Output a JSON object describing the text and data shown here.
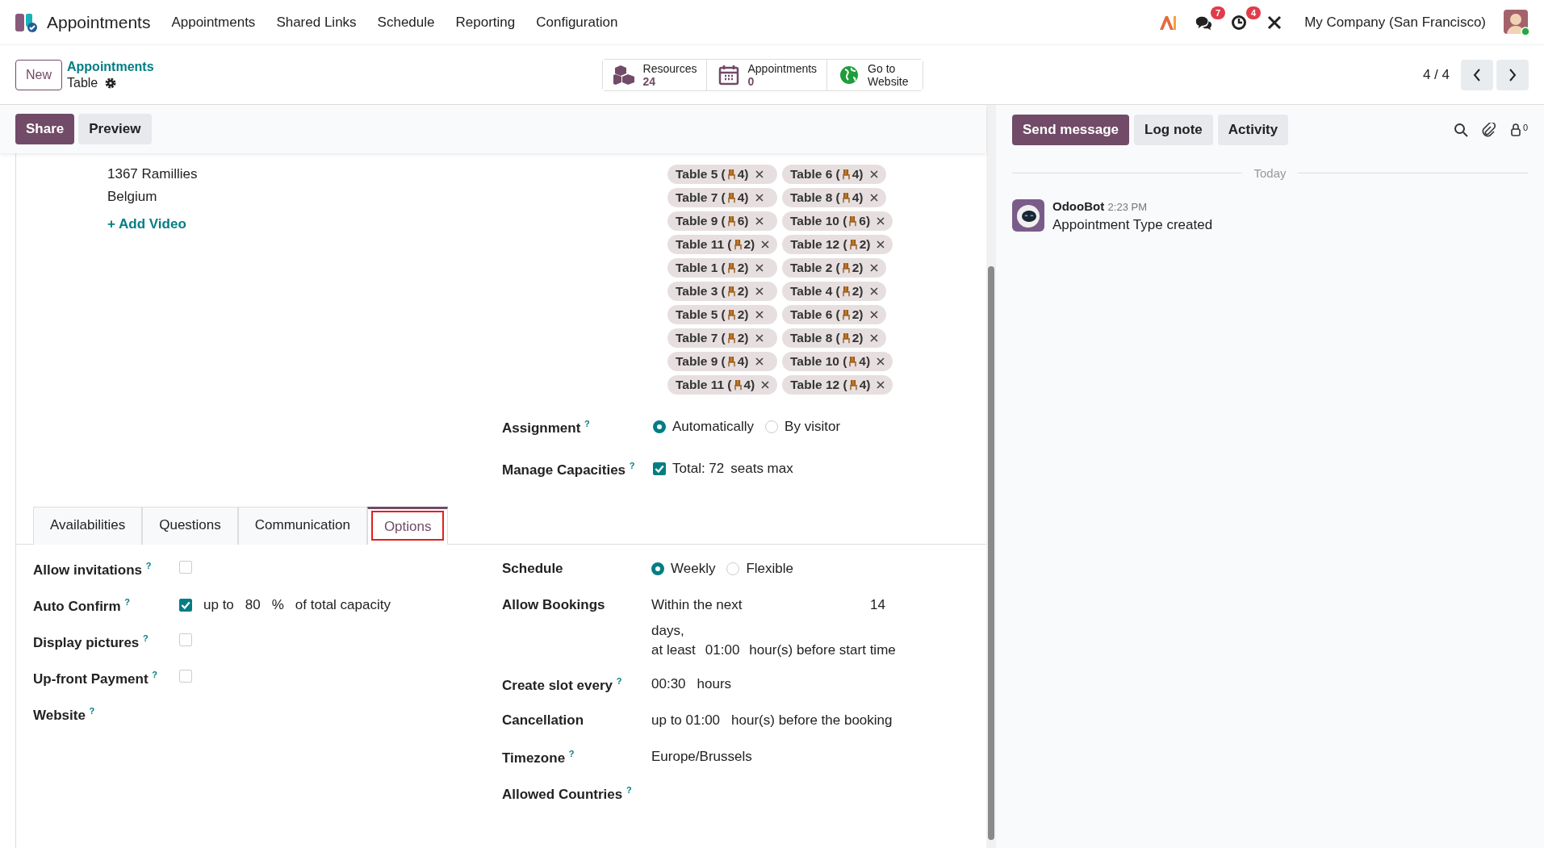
{
  "navbar": {
    "app_name": "Appointments",
    "menu": [
      "Appointments",
      "Shared Links",
      "Schedule",
      "Reporting",
      "Configuration"
    ],
    "messages_badge": "7",
    "activities_badge": "4",
    "company": "My Company (San Francisco)"
  },
  "control_panel": {
    "new_button": "New",
    "breadcrumb": "Appointments",
    "record": "Table",
    "smart_buttons": [
      {
        "kind": "resources",
        "label": "Resources",
        "value": "24"
      },
      {
        "kind": "calendar",
        "label": "Appointments",
        "value": "0"
      },
      {
        "kind": "website",
        "label": "Go to Website"
      }
    ],
    "pager": "4 / 4"
  },
  "actions": [
    {
      "label": "Share",
      "kind": "primary"
    },
    {
      "label": "Preview",
      "kind": "secondary"
    }
  ],
  "address": [
    "1367 Ramillies",
    "Belgium"
  ],
  "add_video": {
    "icon": "+",
    "label": "Add Video"
  },
  "resources": [
    {
      "name": "Table 5 (",
      "seats": "4)"
    },
    {
      "name": "Table 6 (",
      "seats": "4)"
    },
    {
      "name": "Table 7 (",
      "seats": "4)"
    },
    {
      "name": "Table 8 (",
      "seats": "4)"
    },
    {
      "name": "Table 9 (",
      "seats": "6)"
    },
    {
      "name": "Table 10 (",
      "seats": "6)"
    },
    {
      "name": "Table 11 (",
      "seats": "2)"
    },
    {
      "name": "Table 12 (",
      "seats": "2)"
    },
    {
      "name": "Table 1 (",
      "seats": "2)"
    },
    {
      "name": "Table 2 (",
      "seats": "2)"
    },
    {
      "name": "Table 3 (",
      "seats": "2)"
    },
    {
      "name": "Table 4 (",
      "seats": "2)"
    },
    {
      "name": "Table 5 (",
      "seats": "2)"
    },
    {
      "name": "Table 6 (",
      "seats": "2)"
    },
    {
      "name": "Table 7 (",
      "seats": "2)"
    },
    {
      "name": "Table 8 (",
      "seats": "2)"
    },
    {
      "name": "Table 9 (",
      "seats": "4)"
    },
    {
      "name": "Table 10 (",
      "seats": "4)"
    },
    {
      "name": "Table 11 (",
      "seats": "4)"
    },
    {
      "name": "Table 12 (",
      "seats": "4)"
    }
  ],
  "assignment": {
    "label": "Assignment",
    "help": "?",
    "options": [
      {
        "label": "Automatically",
        "selected": true
      },
      {
        "label": "By visitor",
        "selected": false
      }
    ]
  },
  "capacities": {
    "label": "Manage Capacities",
    "help": "?",
    "checked": true,
    "total": "Total: 72",
    "suffix": "seats max"
  },
  "tabs": [
    {
      "label": "Availabilities",
      "selected": false,
      "highlighted": false
    },
    {
      "label": "Questions",
      "selected": false,
      "highlighted": false
    },
    {
      "label": "Communication",
      "selected": false,
      "highlighted": false
    },
    {
      "label": "Options",
      "selected": true,
      "highlighted": true
    }
  ],
  "options_left": [
    {
      "label": "Allow invitations",
      "help": "?",
      "kind": "checkbox",
      "checked": false
    },
    {
      "label": "Auto Confirm",
      "help": "?",
      "kind": "checkbox",
      "checked": true,
      "parts": [
        "up to",
        "80",
        "%",
        "of total capacity"
      ]
    },
    {
      "label": "Display pictures",
      "help": "?",
      "kind": "checkbox",
      "checked": false
    },
    {
      "label": "Up-front Payment",
      "help": "?",
      "kind": "checkbox",
      "checked": false
    },
    {
      "label": "Website",
      "help": "?",
      "kind": "empty"
    }
  ],
  "options_right": [
    {
      "label": "Schedule",
      "kind": "radio",
      "options": [
        {
          "label": "Weekly",
          "selected": true
        },
        {
          "label": "Flexible",
          "selected": false
        }
      ]
    },
    {
      "label": "Allow Bookings",
      "kind": "bookings",
      "within": "Within the next",
      "days_value": "14",
      "days": "days,",
      "at_least": "at least",
      "hours_value": "01:00",
      "hours": "hour(s) before start time"
    },
    {
      "label": "Create slot every",
      "help": "?",
      "kind": "text",
      "parts": [
        "00:30",
        "hours"
      ]
    },
    {
      "label": "Cancellation",
      "kind": "text",
      "parts": [
        "up to 01:00",
        "hour(s) before the booking"
      ]
    },
    {
      "label": "Timezone",
      "help": "?",
      "kind": "text",
      "parts": [
        "Europe/Brussels"
      ]
    },
    {
      "label": "Allowed Countries",
      "help": "?",
      "kind": "empty"
    }
  ],
  "chatter": {
    "buttons": [
      {
        "label": "Send message",
        "kind": "primary"
      },
      {
        "label": "Log note",
        "kind": "secondary"
      },
      {
        "label": "Activity",
        "kind": "secondary"
      }
    ],
    "followers": "0",
    "date": "Today",
    "message": {
      "author": "OdooBot",
      "time": "2:23 PM",
      "body": "Appointment Type created"
    }
  }
}
